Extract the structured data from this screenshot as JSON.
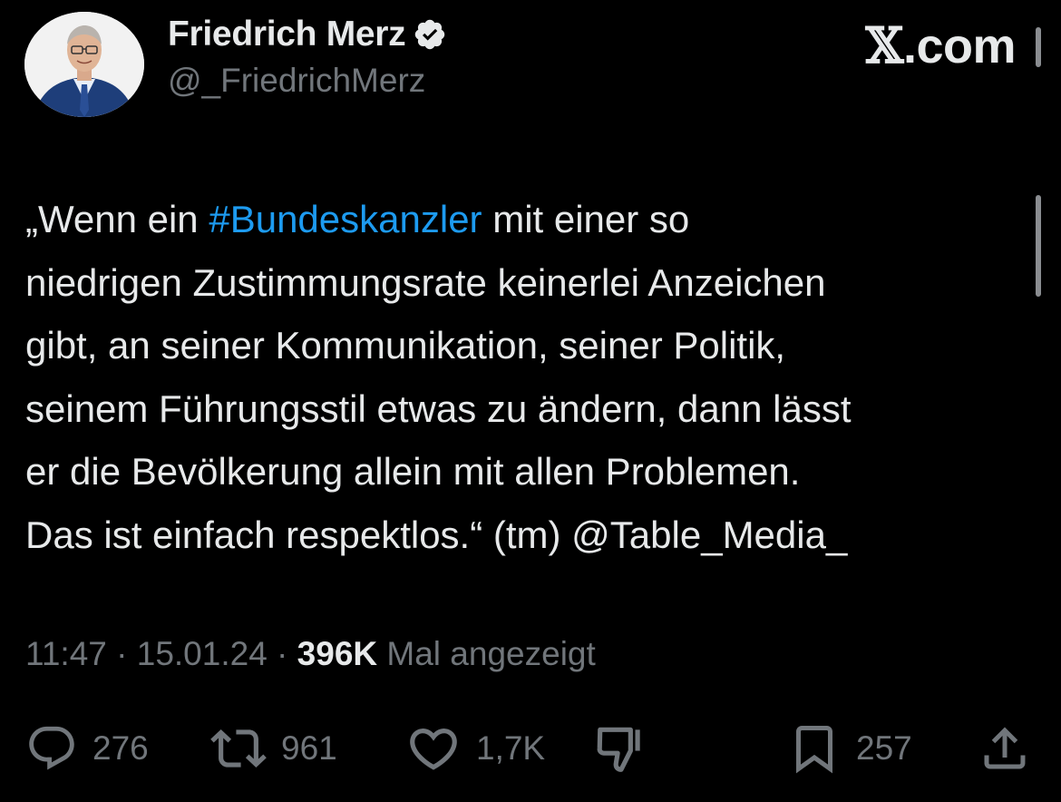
{
  "author": {
    "display_name": "Friedrich Merz",
    "handle": "@_FriedrichMerz",
    "verified": true
  },
  "watermark": {
    "x_glyph": "𝕏",
    "domain_suffix": ".com"
  },
  "tweet": {
    "lines": [
      {
        "pre": "„Wenn ein ",
        "hashtag": "#Bundeskanzler",
        "post": " mit einer so"
      },
      {
        "text": "niedrigen Zustimmungsrate keinerlei Anzeichen"
      },
      {
        "text": "gibt, an seiner Kommunikation, seiner Politik,"
      },
      {
        "text": "seinem Führungsstil etwas zu ändern, dann lässt"
      },
      {
        "text": "er die Bevölkerung allein mit allen Problemen."
      },
      {
        "text": "Das ist einfach respektlos.“ (tm) @Table_Media_"
      }
    ]
  },
  "meta": {
    "time": "11:47",
    "separator": " · ",
    "date": "15.01.24",
    "views_count": "396K",
    "views_label": " Mal angezeigt"
  },
  "actions": {
    "replies": "276",
    "reposts": "961",
    "likes": "1,7K",
    "bookmarks": "257"
  },
  "colors": {
    "background": "#000000",
    "text": "#e7e9ea",
    "muted": "#71767b",
    "link": "#1d9bf0",
    "verified_badge": "#e7e9ea"
  }
}
